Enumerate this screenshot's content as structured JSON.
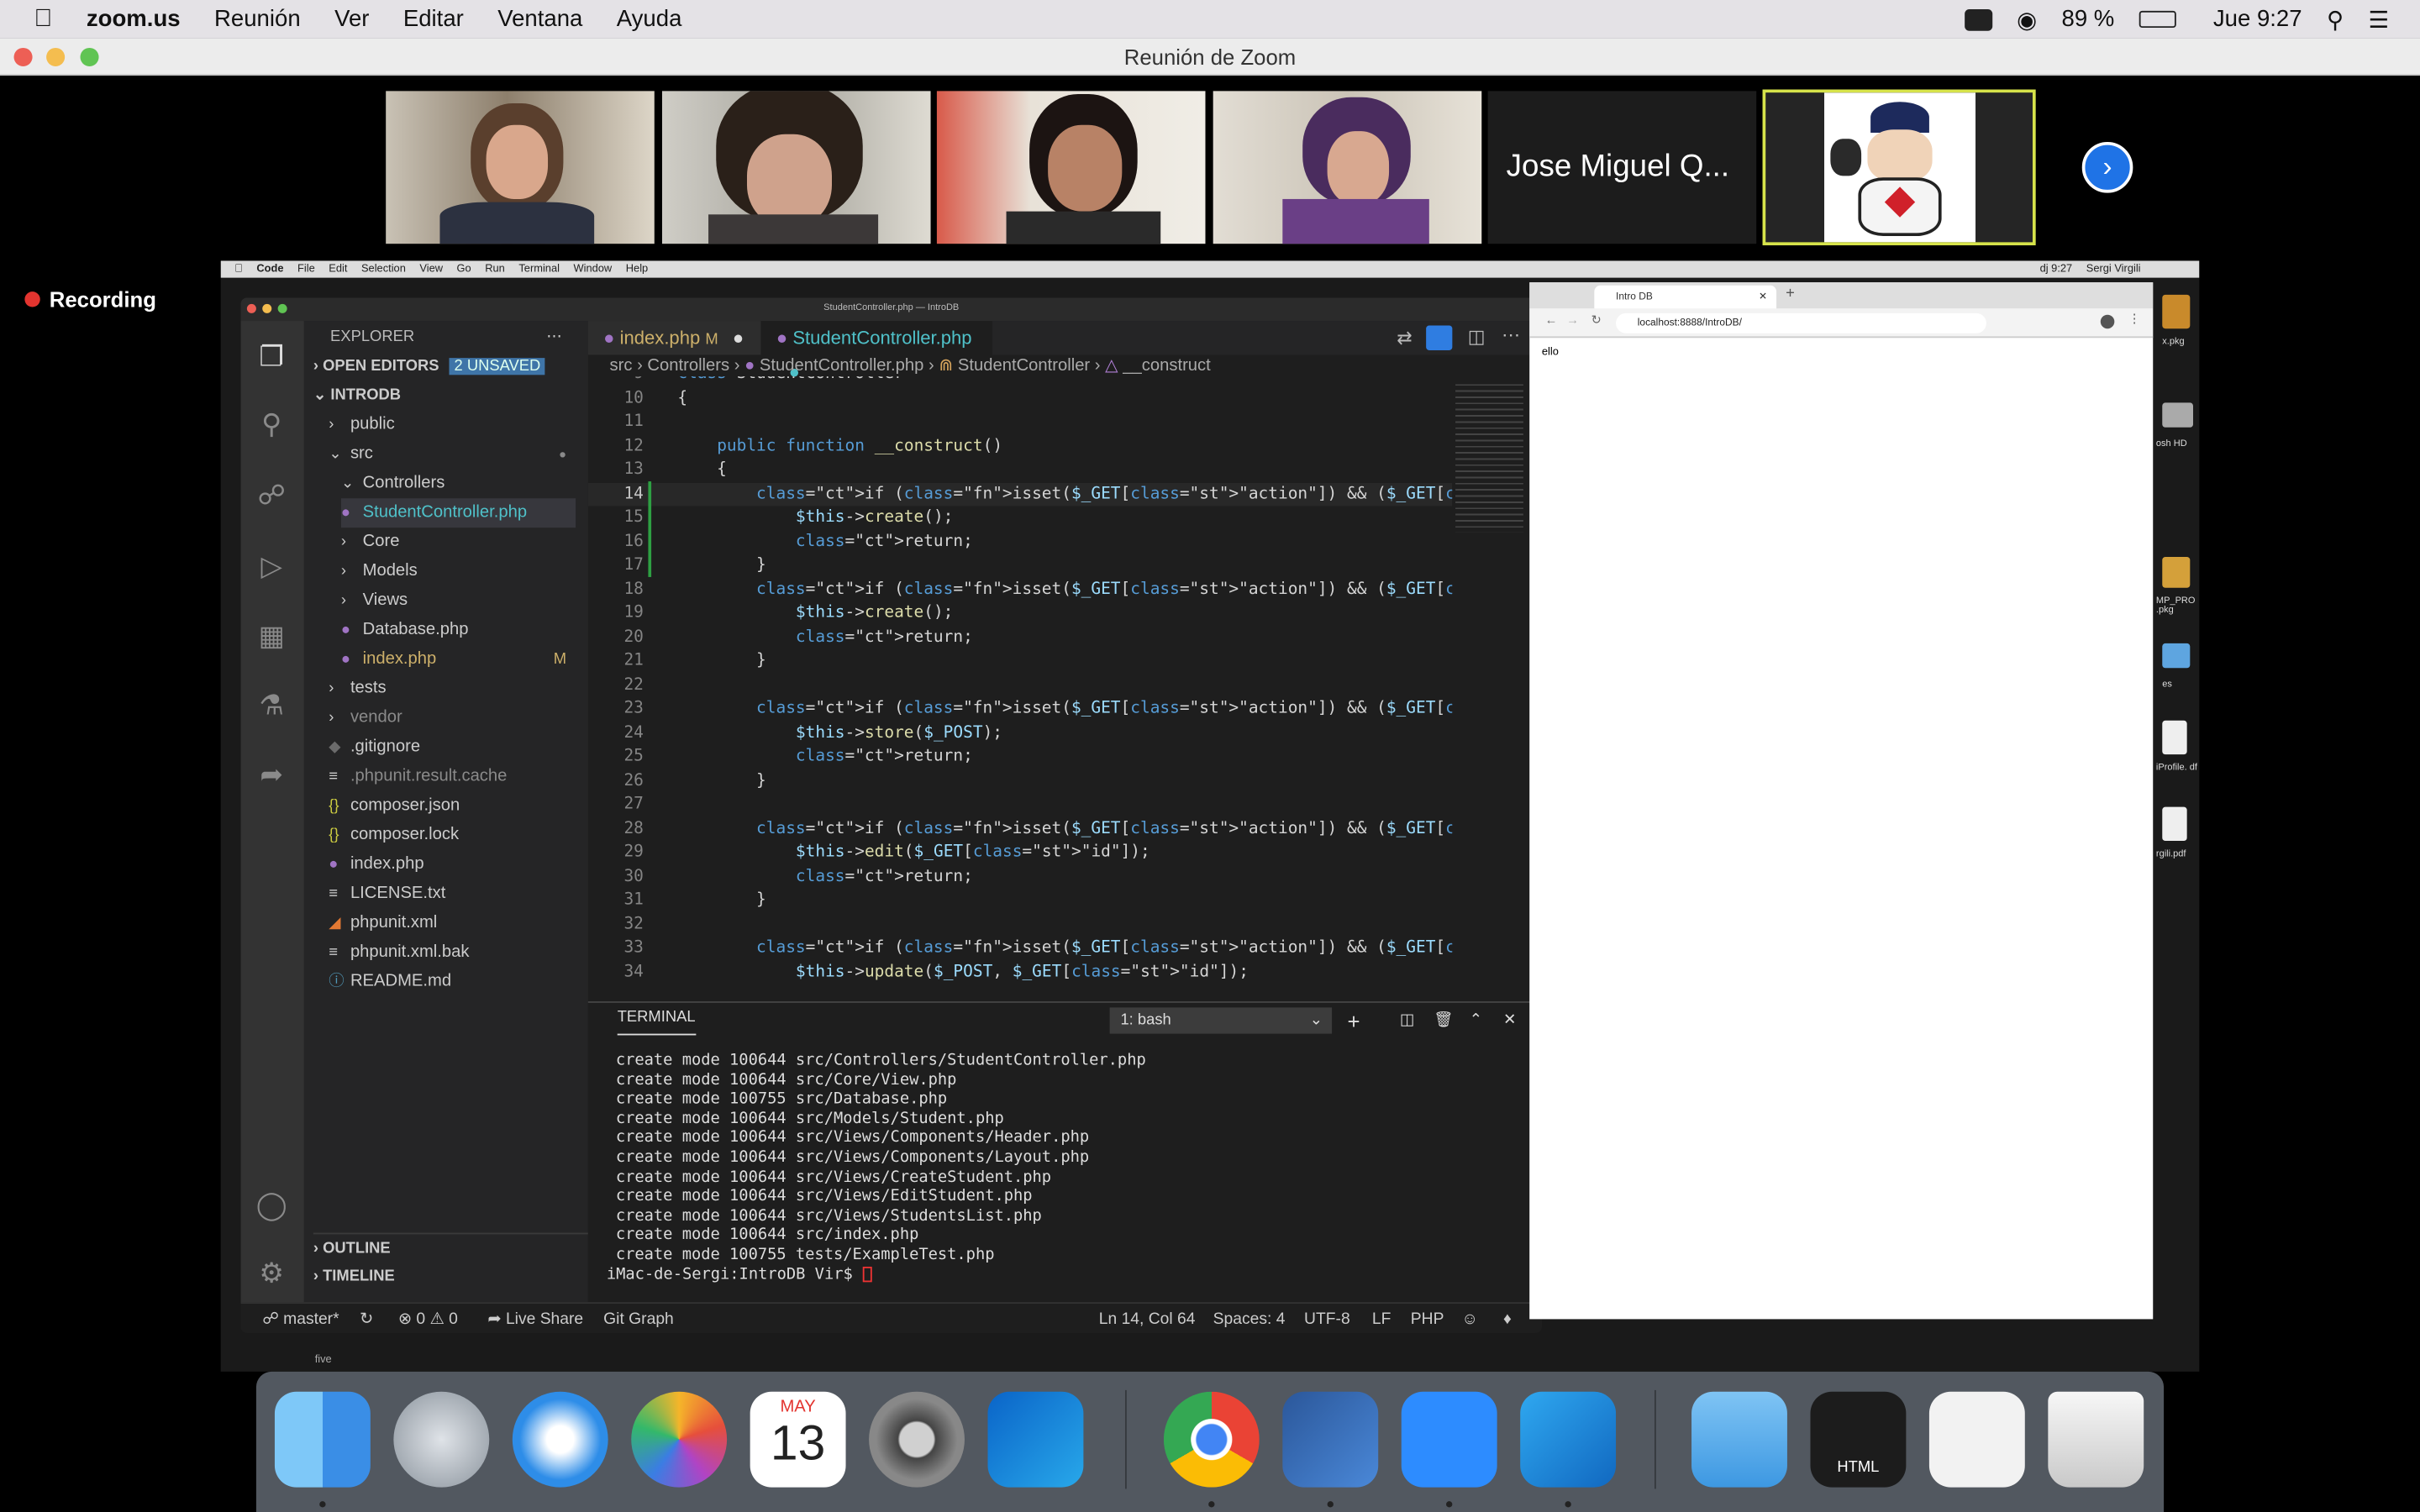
{
  "menubar": {
    "app": "zoom.us",
    "items": [
      "Reunión",
      "Ver",
      "Editar",
      "Ventana",
      "Ayuda"
    ],
    "battery": "89 %",
    "clock": "Jue 9:27"
  },
  "zoom": {
    "window_title": "Reunión de Zoom",
    "participant_name": "Jose Miguel Q...",
    "recording_label": "Recording",
    "next_icon": "chevron-right-icon"
  },
  "inner_menubar": {
    "items": [
      "Code",
      "File",
      "Edit",
      "Selection",
      "View",
      "Go",
      "Run",
      "Terminal",
      "Window",
      "Help"
    ],
    "clock": "dj 9:27",
    "user": "Sergi Virgili"
  },
  "vscode": {
    "window_title": "StudentController.php — IntroDB",
    "explorer_label": "EXPLORER",
    "open_editors_label": "OPEN EDITORS",
    "unsaved_badge": "2 UNSAVED",
    "project_label": "INTRODB",
    "tree": [
      {
        "label": "public",
        "icon": "chevron-right-icon",
        "level": 1
      },
      {
        "label": "src",
        "icon": "chevron-down-icon",
        "level": 1
      },
      {
        "label": "Controllers",
        "icon": "chevron-down-icon",
        "level": 2
      },
      {
        "label": "StudentController.php",
        "icon": "php-file-icon",
        "level": 3
      },
      {
        "label": "Core",
        "icon": "chevron-right-icon",
        "level": 2
      },
      {
        "label": "Models",
        "icon": "chevron-right-icon",
        "level": 2
      },
      {
        "label": "Views",
        "icon": "chevron-right-icon",
        "level": 2
      },
      {
        "label": "Database.php",
        "icon": "php-file-icon",
        "level": 2
      },
      {
        "label": "index.php",
        "icon": "php-file-icon",
        "level": 2,
        "badge": "M"
      },
      {
        "label": "tests",
        "icon": "chevron-right-icon",
        "level": 1
      },
      {
        "label": "vendor",
        "icon": "chevron-right-icon",
        "level": 1
      },
      {
        "label": ".gitignore",
        "icon": "git-icon",
        "level": 1
      },
      {
        "label": ".phpunit.result.cache",
        "icon": "text-file-icon",
        "level": 1
      },
      {
        "label": "composer.json",
        "icon": "json-icon",
        "level": 1
      },
      {
        "label": "composer.lock",
        "icon": "json-icon",
        "level": 1
      },
      {
        "label": "index.php",
        "icon": "php-file-icon",
        "level": 1
      },
      {
        "label": "LICENSE.txt",
        "icon": "text-file-icon",
        "level": 1
      },
      {
        "label": "phpunit.xml",
        "icon": "rss-icon",
        "level": 1
      },
      {
        "label": "phpunit.xml.bak",
        "icon": "text-file-icon",
        "level": 1
      },
      {
        "label": "README.md",
        "icon": "info-icon",
        "level": 1
      }
    ],
    "outline_label": "OUTLINE",
    "timeline_label": "TIMELINE",
    "tabs": [
      {
        "label": "index.php",
        "badge": "M"
      },
      {
        "label": "StudentController.php"
      }
    ],
    "breadcrumb": [
      "src",
      "Controllers",
      "StudentController.php",
      "StudentController",
      "__construct"
    ],
    "code_lines": [
      {
        "n": "9",
        "text": "class StudentController"
      },
      {
        "n": "10",
        "text": "{"
      },
      {
        "n": "11",
        "text": ""
      },
      {
        "n": "12",
        "text": "    public function __construct()"
      },
      {
        "n": "13",
        "text": "    {"
      },
      {
        "n": "14",
        "text": "        if (isset($_GET[\"action\"]) && ($_GET[\"action\"] == \"test\")) {"
      },
      {
        "n": "15",
        "text": "            $this->create();"
      },
      {
        "n": "16",
        "text": "            return;"
      },
      {
        "n": "17",
        "text": "        }"
      },
      {
        "n": "18",
        "text": "        if (isset($_GET[\"action\"]) && ($_GET[\"action\"] == \"create\")) {"
      },
      {
        "n": "19",
        "text": "            $this->create();"
      },
      {
        "n": "20",
        "text": "            return;"
      },
      {
        "n": "21",
        "text": "        }"
      },
      {
        "n": "22",
        "text": ""
      },
      {
        "n": "23",
        "text": "        if (isset($_GET[\"action\"]) && ($_GET[\"action\"] == \"store\")) {"
      },
      {
        "n": "24",
        "text": "            $this->store($_POST);"
      },
      {
        "n": "25",
        "text": "            return;"
      },
      {
        "n": "26",
        "text": "        }"
      },
      {
        "n": "27",
        "text": ""
      },
      {
        "n": "28",
        "text": "        if (isset($_GET[\"action\"]) && ($_GET[\"action\"] == \"edit\")) {"
      },
      {
        "n": "29",
        "text": "            $this->edit($_GET[\"id\"]);"
      },
      {
        "n": "30",
        "text": "            return;"
      },
      {
        "n": "31",
        "text": "        }"
      },
      {
        "n": "32",
        "text": ""
      },
      {
        "n": "33",
        "text": "        if (isset($_GET[\"action\"]) && ($_GET[\"action\"] == \"update\")) {"
      },
      {
        "n": "34",
        "text": "            $this->update($_POST, $_GET[\"id\"]);"
      }
    ],
    "terminal": {
      "label": "TERMINAL",
      "shell_select": "1: bash",
      "lines": [
        "create mode 100644 src/Controllers/StudentController.php",
        "create mode 100644 src/Core/View.php",
        "create mode 100755 src/Database.php",
        "create mode 100644 src/Models/Student.php",
        "create mode 100644 src/Views/Components/Header.php",
        "create mode 100644 src/Views/Components/Layout.php",
        "create mode 100644 src/Views/CreateStudent.php",
        "create mode 100644 src/Views/EditStudent.php",
        "create mode 100644 src/Views/StudentsList.php",
        "create mode 100644 src/index.php",
        "create mode 100755 tests/ExampleTest.php"
      ],
      "prompt": "iMac-de-Sergi:IntroDB Vir$ "
    },
    "status": {
      "branch": "master*",
      "problems": "⊗ 0 ⚠ 0",
      "live_share": "Live Share",
      "git_graph": "Git Graph",
      "position": "Ln 14, Col 64",
      "spaces": "Spaces: 4",
      "encoding": "UTF-8",
      "eol": "LF",
      "language": "PHP"
    },
    "below_label": "five"
  },
  "browser": {
    "tab_title": "Intro DB",
    "url": "localhost:8888/IntroDB/",
    "page_text": "ello"
  },
  "desktop_icons": [
    "x.pkg",
    "osh HD",
    "MP_PRO .pkg",
    "es",
    "iProfile. df",
    "rgili.pdf"
  ],
  "dock": {
    "calendar_month": "MAY",
    "calendar_day": "13",
    "html_label": "HTML",
    "apps": [
      "finder-icon",
      "launchpad-icon",
      "safari-icon",
      "photos-icon",
      "calendar-icon",
      "system-preferences-icon",
      "outlook-icon",
      "chrome-icon",
      "word-icon",
      "zoom-icon",
      "vscode-icon",
      "folder-icon",
      "html-file-icon",
      "screenshot-icon",
      "trash-icon"
    ]
  }
}
